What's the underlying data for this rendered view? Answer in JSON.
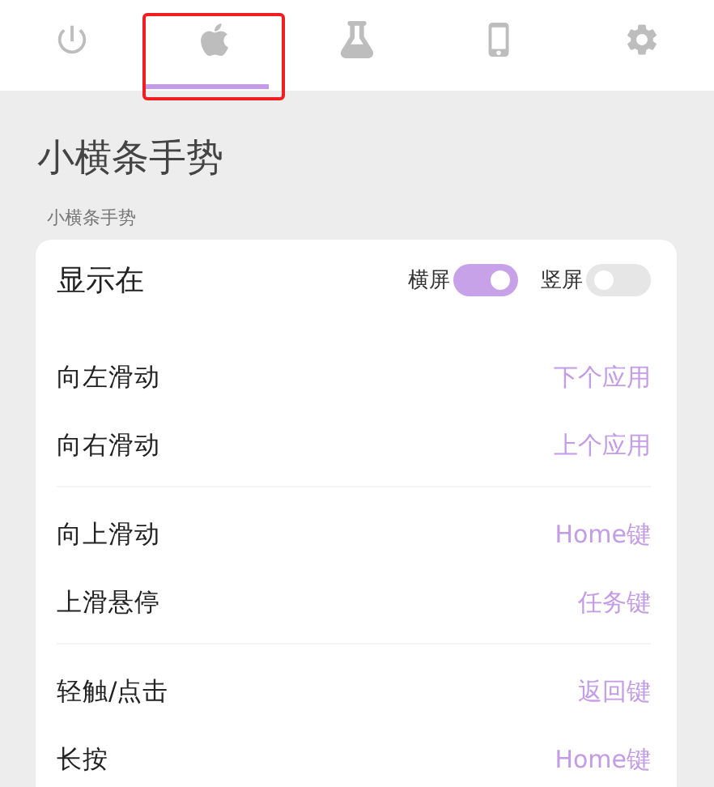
{
  "tabs": [
    {
      "selected": false,
      "highlighted": false
    },
    {
      "selected": true,
      "highlighted": true
    },
    {
      "selected": false,
      "highlighted": false
    },
    {
      "selected": false,
      "highlighted": false
    },
    {
      "selected": false,
      "highlighted": false
    }
  ],
  "page_title": "小横条手势",
  "section_label": "小横条手势",
  "display": {
    "label": "显示在",
    "switches": [
      {
        "label": "横屏",
        "on": true
      },
      {
        "label": "竖屏",
        "on": false
      }
    ]
  },
  "groups": [
    [
      {
        "label": "向左滑动",
        "value": "下个应用"
      },
      {
        "label": "向右滑动",
        "value": "上个应用"
      }
    ],
    [
      {
        "label": "向上滑动",
        "value": "Home键"
      },
      {
        "label": "上滑悬停",
        "value": "任务键"
      }
    ],
    [
      {
        "label": "轻触/点击",
        "value": "返回键"
      },
      {
        "label": "长按",
        "value": "Home键"
      }
    ]
  ]
}
